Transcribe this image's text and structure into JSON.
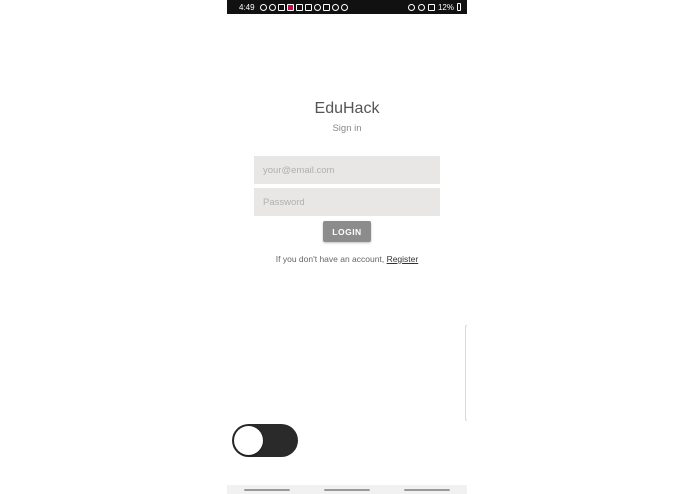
{
  "status_bar": {
    "time": "4:49",
    "battery": "12%"
  },
  "app": {
    "title": "EduHack",
    "subtitle": "Sign in"
  },
  "form": {
    "email_placeholder": "your@email.com",
    "password_placeholder": "Password",
    "login_label": "LOGIN"
  },
  "register": {
    "prompt": "If you don't have an account,",
    "link_label": "Register"
  },
  "toggle": {
    "state": "off"
  }
}
